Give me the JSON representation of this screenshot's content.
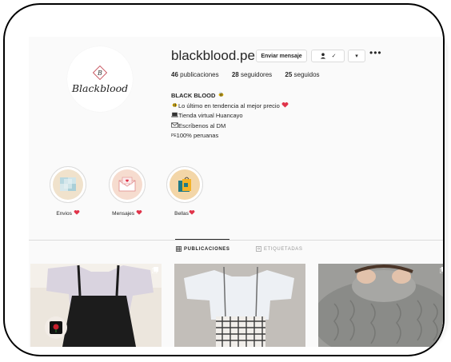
{
  "profile": {
    "username": "blackblood.pe",
    "logo_letter": "B",
    "logo_text": "Blackblood",
    "buttons": {
      "message": "Enviar mensaje",
      "follow": "✓",
      "more": "▾",
      "options": "•••"
    },
    "stats": [
      {
        "count": "46",
        "label": "publicaciones"
      },
      {
        "count": "28",
        "label": "seguidores"
      },
      {
        "count": "25",
        "label": "seguidos"
      }
    ],
    "bio": {
      "name": "BLACK BLOOD",
      "lines": [
        "Lo último en tendencia al mejor precio",
        "Tienda virtual Huancayo",
        "Escríbenos al DM",
        "100% peruanas"
      ],
      "line4_prefix": "PE"
    }
  },
  "highlights": [
    {
      "label": "Envios",
      "icon": "boxes-icon"
    },
    {
      "label": "Mensajes",
      "icon": "envelope-icon"
    },
    {
      "label": "Bellas",
      "icon": "shopping-bag-icon"
    }
  ],
  "tabs": [
    {
      "label": "PUBLICACIONES",
      "icon": "grid-icon",
      "active": true
    },
    {
      "label": "ETIQUETADAS",
      "icon": "tag-icon",
      "active": false
    }
  ],
  "posts": [
    {
      "subject": "black pinafore dress over white t-shirt",
      "icon": "rose-icon"
    },
    {
      "subject": "plaid strap dress over white crop top",
      "icon": "multi-photo-icon"
    },
    {
      "subject": "grey knit sweater",
      "icon": "multi-photo-icon"
    }
  ],
  "colors": {
    "background": "#fafafa",
    "text": "#262626",
    "border": "#dbdbdb",
    "heart": "#e0344a"
  }
}
